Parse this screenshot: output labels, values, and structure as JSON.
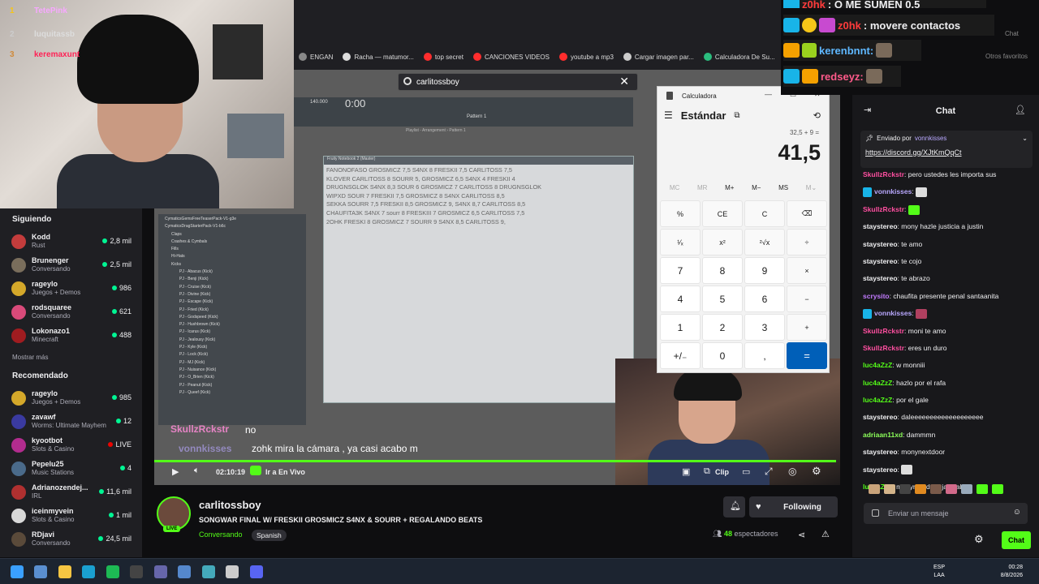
{
  "browser": {
    "bookmarks": [
      "ENGAN",
      "Racha — matumor...",
      "top secret",
      "CANCIONES VIDEOS",
      "youtube a mp3",
      "Cargar imagen par...",
      "Calculadora De Su..."
    ],
    "bookmark_colors": [
      "#888888",
      "#dddddd",
      "#ff2d2d",
      "#ff2d2d",
      "#ff2d2d",
      "#cccccc",
      "#2bbd7e"
    ],
    "right_bookmark": "Otros favoritos",
    "chat_tab": "Chat"
  },
  "webcam_overlay": {
    "ranks": [
      {
        "n": "1",
        "name": "TetePink"
      },
      {
        "n": "2",
        "name": "luquitassb"
      },
      {
        "n": "3",
        "name": "keremaxunt"
      }
    ]
  },
  "sidebar": {
    "following_title": "Siguiendo",
    "following": [
      {
        "name": "Kodd",
        "category": "Rust",
        "viewers": "2,8 mil",
        "color": "#c33c3c"
      },
      {
        "name": "Brunenger",
        "category": "Conversando",
        "viewers": "2,5 mil",
        "color": "#7a6e5c"
      },
      {
        "name": "rageylo",
        "category": "Juegos + Demos",
        "viewers": "986",
        "color": "#d4a82a"
      },
      {
        "name": "rodsquaree",
        "category": "Conversando",
        "viewers": "621",
        "color": "#d94a7a"
      },
      {
        "name": "Lokonazo1",
        "category": "Minecraft",
        "viewers": "488",
        "color": "#a01c20"
      }
    ],
    "show_more": "Mostrar más",
    "recommended_title": "Recomendado",
    "recommended": [
      {
        "name": "rageylo",
        "category": "Juegos + Demos",
        "viewers": "985",
        "color": "#d4a82a"
      },
      {
        "name": "zavawf",
        "category": "Worms: Ultimate Mayhem",
        "viewers": "12",
        "color": "#3a3aa0"
      },
      {
        "name": "kyootbot",
        "category": "Slots & Casino",
        "viewers": "LIVE",
        "color": "#b22c8e"
      },
      {
        "name": "Pepelu25",
        "category": "Music Stations",
        "viewers": "4",
        "color": "#4a6a8a"
      },
      {
        "name": "Adrianozendej...",
        "category": "IRL",
        "viewers": "11,6 mil",
        "color": "#b03030"
      },
      {
        "name": "iceinmyvein",
        "category": "Slots & Casino",
        "viewers": "1 mil",
        "color": "#d8d8d8"
      },
      {
        "name": "RDjavi",
        "category": "Conversando",
        "viewers": "24,5 mil",
        "color": "#5a4a3a"
      }
    ]
  },
  "stream": {
    "search_value": "carlitossboy",
    "fl_tempo": "140.000",
    "fl_time": "0:00",
    "fl_pattern": "Pattern 1",
    "fl_playlist": "Playlist - Arrangement › Pattern 1",
    "notebook_title": "Fruity Notebook 2 (Master)",
    "notebook_lines": [
      "FANONOFASO GROSMICZ 7,5 S4NX 8 FRESKII 7,5 CARLITOSS 7,5",
      "KLOVER CARLITOSS 8 SOURR 5, GROSMICZ 6,5 S4NX 4 FRESKII 4",
      "DRUGNSGLOK S4NX 8,3 SOUR 6 GROSMICZ 7 CARLITOSS 8 DRUGNSGLOK",
      "WIPXD SOUR 7 FRESKII 7,5 GROSMICZ 8 S4NX CARLITOSS 8,5",
      "SEKKA SOURR 7,5 FRESKII 8,5 GROSMICZ 9, S4NX 8,7 CARLITOSS 8,5",
      "CHAUFITA3K S4NX 7 sourr 8 FRESKIII 7 GROSMICZ 6,5 CARLITOSS 7,5",
      "2OHK FRESKI 8 GROSMICZ 7 SOURR 9 S4NX 8,5 CARLITOSS 9,"
    ],
    "browser_tree": [
      "CymaticsGemsFreeTeaserPack-V1-g3e",
      "CymaticsDragStarterPack-V1-b6c",
      "Claps",
      "Crashes & Cymbals",
      "Fills",
      "Hi-Hats",
      "Kicks",
      "PJ - Abacus (Kick)",
      "PJ - Benji (Kick)",
      "PJ - Cruise (Kick)",
      "PJ - Divine (Kick)",
      "PJ - Escape (Kick)",
      "PJ - Fried (Kick)",
      "PJ - Godspeed (Kick)",
      "PJ - Hushbrown (Kick)",
      "PJ - Icarus (Kick)",
      "PJ - Jealousy (Kick)",
      "PJ - Kyle (Kick)",
      "PJ - Lock (Kick)",
      "PJ - MJ (Kick)",
      "PJ - Nuisance (Kick)",
      "PJ - O_Brien (Kick)",
      "PJ - Peanut (Kick)",
      "PJ - Queef (Kick)"
    ],
    "overlay_chat": [
      {
        "user": "SkullzRckstr",
        "text": "no"
      },
      {
        "user": "vonnkisses",
        "text": "zohk mira la cámara , ya casi acabo m"
      }
    ],
    "time": "02:10:19",
    "live_label": "Ir a En Vivo",
    "clip_label": "Clip"
  },
  "calculator": {
    "title": "Calculadora",
    "mode": "Estándar",
    "expression": "32,5 + 9 =",
    "result": "41,5",
    "memory": [
      "MC",
      "MR",
      "M+",
      "M−",
      "MS",
      "M⌄"
    ],
    "keys": [
      "%",
      "CE",
      "C",
      "⌫",
      "¹⁄ₓ",
      "x²",
      "²√x",
      "÷",
      "7",
      "8",
      "9",
      "×",
      "4",
      "5",
      "6",
      "−",
      "1",
      "2",
      "3",
      "+",
      "+/₋",
      "0",
      ",",
      "="
    ]
  },
  "top_chat": [
    {
      "user": "z0hk",
      "text": ": Q ME SUMEN 0.5"
    },
    {
      "user": "z0hk",
      "text": ": movere contactos"
    },
    {
      "user": "kerenbnnt:",
      "text": ""
    },
    {
      "user": "redseyz:",
      "text": ""
    }
  ],
  "chat": {
    "title": "Chat",
    "pinned_by_label": "Enviado por",
    "pinned_user": "vonnkisses",
    "pinned_link": "https://discord.gg/XJtKmQqCt",
    "messages": [
      {
        "user": "SkullzRckstr",
        "color": "#ff4fa0",
        "text": "pero ustedes les importa sus"
      },
      {
        "user": "vonnkisses",
        "color": "#b9a8ff",
        "text": ""
      },
      {
        "user": "SkullzRckstr",
        "color": "#ff4fa0",
        "text": ""
      },
      {
        "user": "staystereo",
        "color": "#efeff1",
        "text": "mony hazle justicia a justin"
      },
      {
        "user": "staystereo",
        "color": "#efeff1",
        "text": "te amo"
      },
      {
        "user": "staystereo",
        "color": "#efeff1",
        "text": "te cojo"
      },
      {
        "user": "staystereo",
        "color": "#efeff1",
        "text": "te abrazo"
      },
      {
        "user": "scrysito",
        "color": "#c27bff",
        "text": "chaufita presente penal santaanita"
      },
      {
        "user": "vonnkisses",
        "color": "#b9a8ff",
        "text": ""
      },
      {
        "user": "SkullzRckstr",
        "color": "#ff4fa0",
        "text": "moni te amo"
      },
      {
        "user": "SkullzRckstr",
        "color": "#ff4fa0",
        "text": "eres un duro"
      },
      {
        "user": "luc4aZzZ",
        "color": "#53fc18",
        "text": "w monniii"
      },
      {
        "user": "luc4aZzZ",
        "color": "#53fc18",
        "text": "hazlo por el rafa"
      },
      {
        "user": "luc4aZzZ",
        "color": "#53fc18",
        "text": "por el gale"
      },
      {
        "user": "staystereo",
        "color": "#efeff1",
        "text": "daleeeeeeeeeeeeeeeeeee"
      },
      {
        "user": "adriaan11xd",
        "color": "#8cff5a",
        "text": "dammmn"
      },
      {
        "user": "staystereo",
        "color": "#efeff1",
        "text": "monynextdoor"
      },
      {
        "user": "staystereo",
        "color": "#efeff1",
        "text": ""
      },
      {
        "user": "luc4aZzZ",
        "color": "#53fc18",
        "text": "monynextdoor jakdjakjs"
      }
    ],
    "input_placeholder": "Enviar un mensaje",
    "chat_button": "Chat"
  },
  "channel": {
    "name": "carlitossboy",
    "live_badge": "LIVE",
    "title": "SONGWAR FINAL W/ FRESKII GROSMICZ S4NX & SOURR + REGALANDO BEATS",
    "category": "Conversando",
    "tag": "Spanish",
    "follow_label": "Following",
    "viewers": "48",
    "viewers_label": "espectadores"
  },
  "taskbar": {
    "lang": "ESP",
    "lang2": "LAA",
    "time": "00:28",
    "date": "8/8/2026"
  }
}
